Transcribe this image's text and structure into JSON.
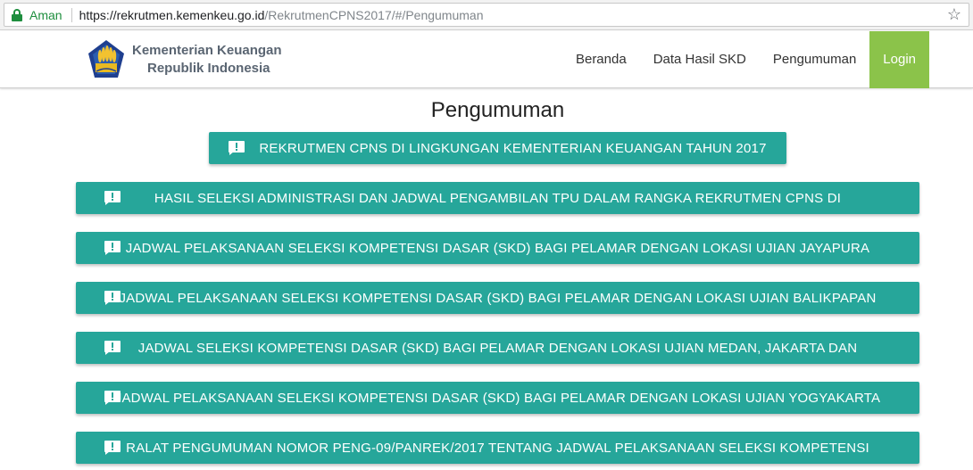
{
  "browser": {
    "secure_label": "Aman",
    "url_host": "https://rekrutmen.kemenkeu.go.id",
    "url_path": "/RekrutmenCPNS2017/#/Pengumuman"
  },
  "brand": {
    "line1": "Kementerian Keuangan",
    "line2": "Republik Indonesia"
  },
  "nav": {
    "items": [
      {
        "label": "Beranda"
      },
      {
        "label": "Data Hasil SKD"
      },
      {
        "label": "Pengumuman"
      },
      {
        "label": "Login"
      }
    ]
  },
  "page": {
    "title": "Pengumuman"
  },
  "announcements": {
    "featured": "REKRUTMEN CPNS DI LINGKUNGAN KEMENTERIAN KEUANGAN TAHUN 2017",
    "items": [
      {
        "label": "HASIL SELEKSI ADMINISTRASI DAN JADWAL PENGAMBILAN TPU DALAM RANGKA REKRUTMEN CPNS DI"
      },
      {
        "label": "JADWAL PELAKSANAAN SELEKSI KOMPETENSI DASAR (SKD) BAGI PELAMAR DENGAN LOKASI UJIAN JAYAPURA"
      },
      {
        "label": "JADWAL PELAKSANAAN SELEKSI KOMPETENSI DASAR (SKD) BAGI PELAMAR DENGAN LOKASI UJIAN BALIKPAPAN"
      },
      {
        "label": "JADWAL SELEKSI KOMPETENSI DASAR (SKD) BAGI PELAMAR DENGAN LOKASI UJIAN MEDAN, JAKARTA DAN"
      },
      {
        "label": "JADWAL PELAKSANAAN SELEKSI KOMPETENSI DASAR (SKD) BAGI PELAMAR DENGAN LOKASI UJIAN YOGYAKARTA"
      },
      {
        "label": "RALAT PENGUMUMAN NOMOR PENG-09/PANREK/2017 TENTANG JADWAL PELAKSANAAN SELEKSI KOMPETENSI"
      }
    ]
  },
  "colors": {
    "teal": "#26a69a",
    "login_green": "#8bc34a",
    "secure_green": "#1e8e3e"
  },
  "icons": {
    "secure": "lock-icon",
    "bookmark": "star-icon",
    "announcement": "announcement-icon",
    "logo": "kemenkeu-logo"
  }
}
